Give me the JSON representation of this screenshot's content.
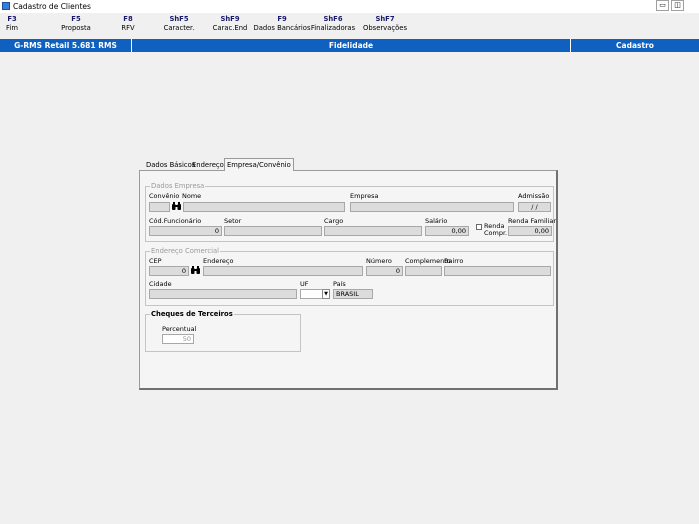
{
  "window": {
    "title": "Cadastro de Clientes",
    "minimize_glyph": "▭",
    "restore_glyph": "◫",
    "close_glyph": "✕"
  },
  "toolbar": {
    "keys": [
      {
        "key": "F3",
        "label": "Fim"
      },
      {
        "key": "F5",
        "label": "Proposta"
      },
      {
        "key": "F8",
        "label": "RFV"
      },
      {
        "key": "ShF5",
        "label": "Caracter."
      },
      {
        "key": "ShF9",
        "label": "Carac.End"
      },
      {
        "key": "F9",
        "label": "Dados Bancários"
      },
      {
        "key": "ShF6",
        "label": "Finalizadoras"
      },
      {
        "key": "ShF7",
        "label": "Observações"
      }
    ]
  },
  "status_bar": {
    "version": "G-RMS Retail 5.681 RMS",
    "module": "Fidelidade",
    "mode": "Cadastro",
    "background_color": "#1060c0"
  },
  "tabs": [
    {
      "label": "Dados Básicos"
    },
    {
      "label": "Endereços"
    },
    {
      "label": "Empresa/Convênio",
      "active": true
    }
  ],
  "dados_empresa": {
    "title": "Dados Empresa",
    "convenio_label": "Convênio",
    "nome_label": "Nome",
    "empresa_label": "Empresa",
    "admissao_label": "Admissão",
    "admissao_value": " / /",
    "cod_funcionario_label": "Cód.Funcionário",
    "cod_funcionario_value": "0",
    "setor_label": "Setor",
    "cargo_label": "Cargo",
    "salario_label": "Salário",
    "salario_value": "0,00",
    "renda_compr_label_1": "Renda",
    "renda_compr_label_2": "Compr.",
    "renda_familiar_label": "Renda Familiar",
    "renda_familiar_value": "0,00",
    "search_icon": "binoculars-icon"
  },
  "endereco_comercial": {
    "title": "Endereço Comercial",
    "cep_label": "CEP",
    "cep_value": "0",
    "endereco_label": "Endereço",
    "numero_label": "Número",
    "numero_value": "0",
    "complemento_label": "Complemento",
    "bairro_label": "Bairro",
    "cidade_label": "Cidade",
    "uf_label": "UF",
    "pais_label": "País",
    "pais_value": "BRASIL",
    "search_icon": "binoculars-icon"
  },
  "cheques_terceiros": {
    "title": "Cheques de Terceiros",
    "percentual_label": "Percentual",
    "percentual_value": "50"
  }
}
